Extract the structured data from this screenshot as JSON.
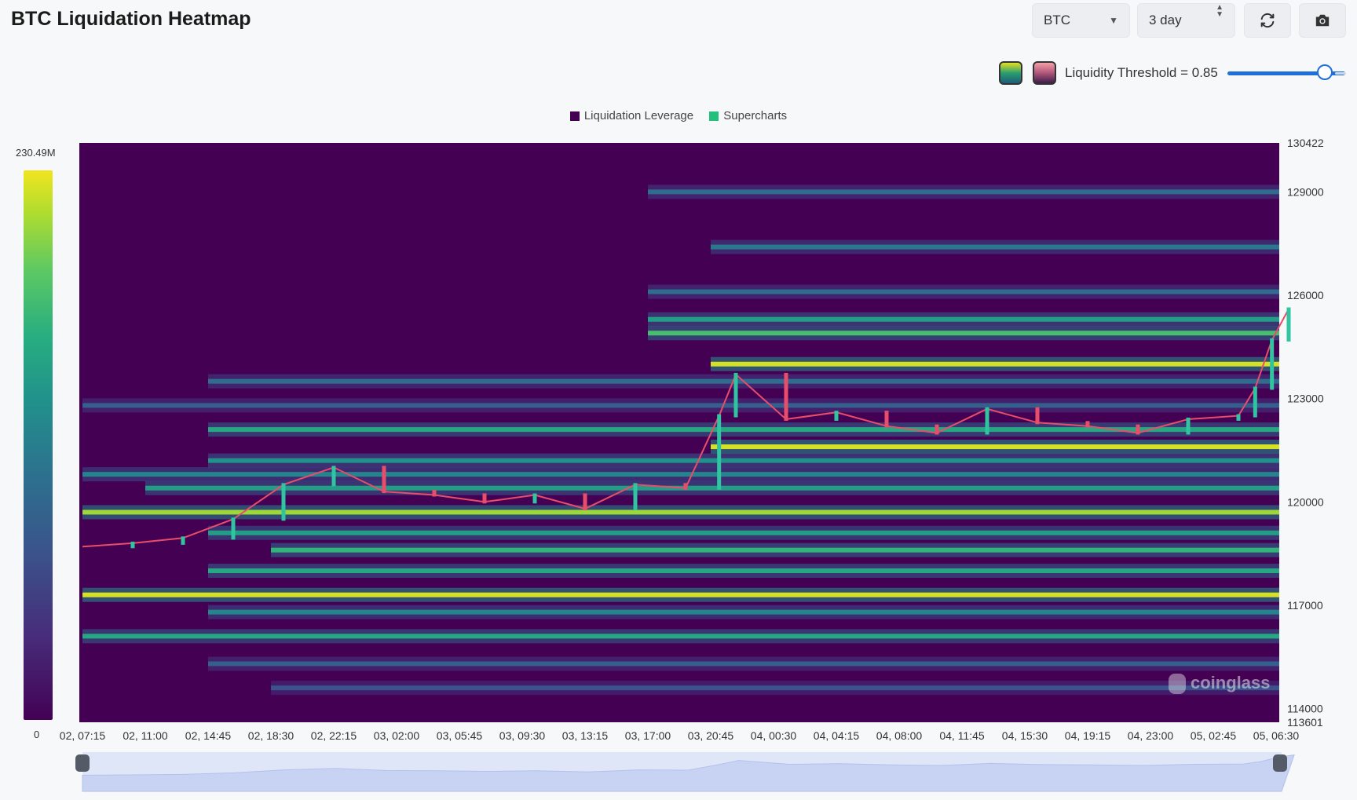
{
  "header": {
    "title": "BTC Liquidation Heatmap",
    "coin_select": "BTC",
    "range_select": "3 day",
    "refresh_icon": "refresh-icon",
    "camera_icon": "camera-icon"
  },
  "threshold": {
    "label": "Liquidity Threshold = 0.85",
    "value": 0.85,
    "swatch_1": [
      "#2b9e6e",
      "#e3e022"
    ],
    "swatch_2": [
      "#f3a0a6",
      "#3b1d4a"
    ]
  },
  "legend": [
    {
      "name": "Liquidation Leverage",
      "color": "#440154"
    },
    {
      "name": "Supercharts",
      "color": "#22c07a"
    }
  ],
  "colorbar": {
    "max_label": "230.49M",
    "min_label": "0",
    "colormap": "viridis"
  },
  "watermark": "coinglass",
  "chart_data": {
    "type": "heatmap",
    "title": "BTC Liquidation Heatmap",
    "x_ticks": [
      "02, 07:15",
      "02, 11:00",
      "02, 14:45",
      "02, 18:30",
      "02, 22:15",
      "03, 02:00",
      "03, 05:45",
      "03, 09:30",
      "03, 13:15",
      "03, 17:00",
      "03, 20:45",
      "04, 00:30",
      "04, 04:15",
      "04, 08:00",
      "04, 11:45",
      "04, 15:30",
      "04, 19:15",
      "04, 23:00",
      "05, 02:45",
      "05, 06:30"
    ],
    "y_ticks": [
      130422,
      129000,
      126000,
      123000,
      120000,
      117000,
      114000,
      113601
    ],
    "ylim": [
      113601,
      130422
    ],
    "colorbar_range": [
      "0",
      "230.49M"
    ],
    "price_series_hours_from_start": [
      0,
      3,
      6,
      9,
      12,
      15,
      18,
      21,
      24,
      27,
      30,
      33,
      36,
      38,
      39,
      42,
      45,
      48,
      51,
      54,
      57,
      60,
      63,
      66,
      69,
      70,
      71,
      72
    ],
    "price_series": [
      118700,
      118800,
      118950,
      119500,
      120500,
      121000,
      120300,
      120200,
      120000,
      120200,
      119800,
      120500,
      120400,
      122500,
      123700,
      122400,
      122600,
      122200,
      122000,
      122700,
      122300,
      122200,
      122000,
      122400,
      122500,
      123300,
      124700,
      125600
    ],
    "liquidation_bands": [
      {
        "price": 129000,
        "start_tick": "03, 17:00",
        "intensity": 0.35
      },
      {
        "price": 127400,
        "start_tick": "03, 20:45",
        "intensity": 0.4
      },
      {
        "price": 126100,
        "start_tick": "03, 17:00",
        "intensity": 0.35
      },
      {
        "price": 125300,
        "start_tick": "03, 17:00",
        "intensity": 0.55
      },
      {
        "price": 124900,
        "start_tick": "03, 17:00",
        "intensity": 0.7
      },
      {
        "price": 124000,
        "start_tick": "03, 20:45",
        "intensity": 0.95
      },
      {
        "price": 123500,
        "start_tick": "02, 14:45",
        "intensity": 0.35
      },
      {
        "price": 122800,
        "start_tick": "02, 07:15",
        "intensity": 0.3
      },
      {
        "price": 122100,
        "start_tick": "02, 14:45",
        "intensity": 0.6
      },
      {
        "price": 121600,
        "start_tick": "03, 20:45",
        "intensity": 0.95
      },
      {
        "price": 121200,
        "start_tick": "02, 14:45",
        "intensity": 0.5
      },
      {
        "price": 120800,
        "start_tick": "02, 07:15",
        "intensity": 0.45
      },
      {
        "price": 120400,
        "start_tick": "02, 11:00",
        "intensity": 0.55
      },
      {
        "price": 119700,
        "start_tick": "02, 07:15",
        "intensity": 0.85
      },
      {
        "price": 119100,
        "start_tick": "02, 14:45",
        "intensity": 0.55
      },
      {
        "price": 118600,
        "start_tick": "02, 18:30",
        "intensity": 0.65
      },
      {
        "price": 118000,
        "start_tick": "02, 14:45",
        "intensity": 0.6
      },
      {
        "price": 117300,
        "start_tick": "02, 07:15",
        "intensity": 0.95
      },
      {
        "price": 116800,
        "start_tick": "02, 14:45",
        "intensity": 0.45
      },
      {
        "price": 116100,
        "start_tick": "02, 07:15",
        "intensity": 0.6
      },
      {
        "price": 115300,
        "start_tick": "02, 14:45",
        "intensity": 0.3
      },
      {
        "price": 114600,
        "start_tick": "02, 18:30",
        "intensity": 0.25
      }
    ]
  }
}
